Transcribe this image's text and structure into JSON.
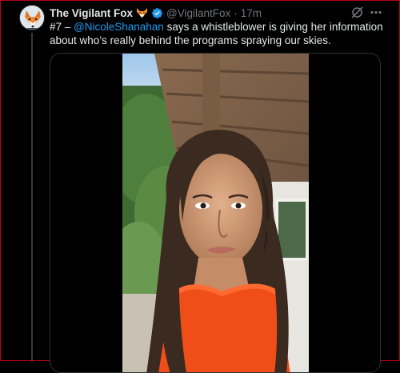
{
  "tweet": {
    "display_name": "The Vigilant Fox",
    "badge_emoji": "fox-emoji",
    "verified": true,
    "handle": "@VigilantFox",
    "separator": "·",
    "time": "17m",
    "text_prefix": "#7 – ",
    "mention": "@NicoleShanahan",
    "text_body": " says a whistleblower is giving her information about who’s really behind the programs spraying our skies.",
    "media": {
      "type": "video",
      "description_icon": "video-thumbnail"
    }
  },
  "colors": {
    "background": "#000000",
    "text": "#e7e9ea",
    "secondary": "#71767b",
    "link": "#1d9bf0",
    "verified": "#1d9bf0",
    "border_highlight": "#b8001a"
  },
  "icons": {
    "grok": "grok-icon",
    "more": "more-icon",
    "verified": "verified-badge-icon"
  }
}
